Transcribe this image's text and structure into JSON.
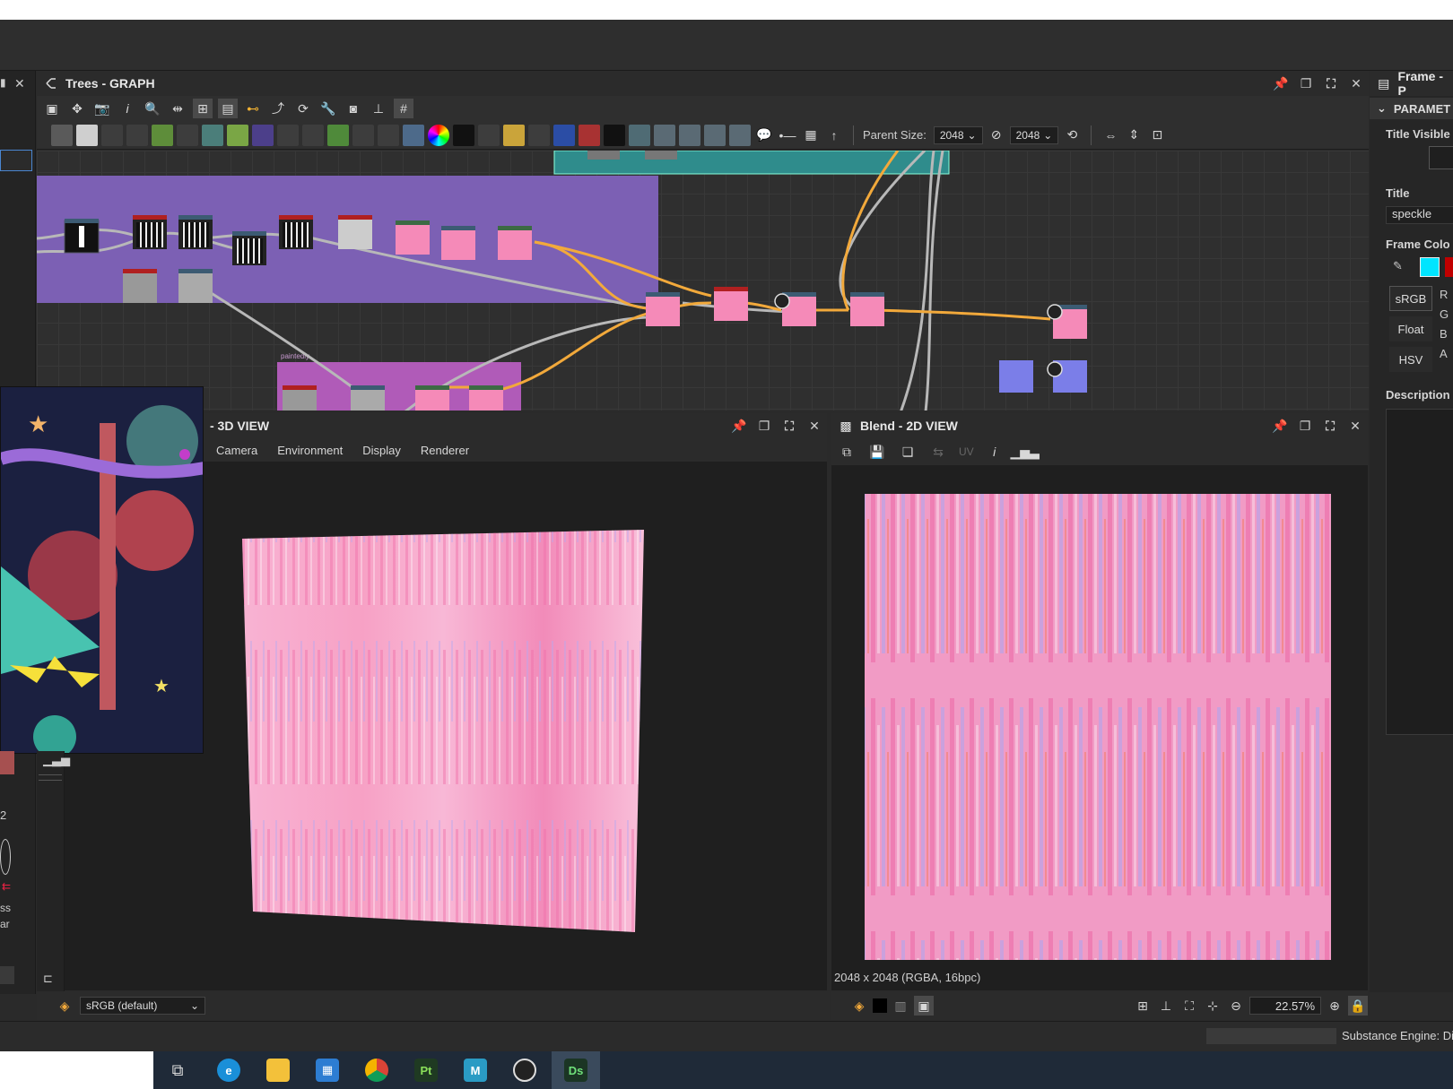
{
  "graph": {
    "title": "Trees - GRAPH",
    "parent_size_label": "Parent Size:",
    "parent_size_w": "2048",
    "parent_size_h": "2048",
    "frame_label": "paintedly"
  },
  "params": {
    "title": "Frame - P",
    "section": "PARAMET",
    "title_visible_label": "Title Visible",
    "title_label": "Title",
    "title_value": "speckle",
    "frame_color_label": "Frame Colo",
    "srgb": "sRGB",
    "float": "Float",
    "hsv": "HSV",
    "channel_r": "R",
    "channel_g": "G",
    "channel_b": "B",
    "channel_a": "A",
    "description_label": "Description",
    "swatch_cyan": "#00e5ff",
    "swatch_red": "#c00000"
  },
  "view3d": {
    "title": "- 3D VIEW",
    "menu": [
      "Camera",
      "Environment",
      "Display",
      "Renderer"
    ],
    "colorspace": "sRGB (default)"
  },
  "view2d": {
    "title": "Blend - 2D VIEW",
    "uv_label": "UV",
    "info": "2048 x 2048 (RGBA, 16bpc)",
    "zoom": "22.57%"
  },
  "left_misc": {
    "text1": "ss",
    "text2": "ar"
  },
  "status": {
    "engine": "Substance Engine: Di"
  },
  "taskbar": {
    "apps": [
      "task-view",
      "edge",
      "file-explorer",
      "store",
      "chrome",
      "Pt",
      "M",
      "obs",
      "Ds"
    ]
  }
}
